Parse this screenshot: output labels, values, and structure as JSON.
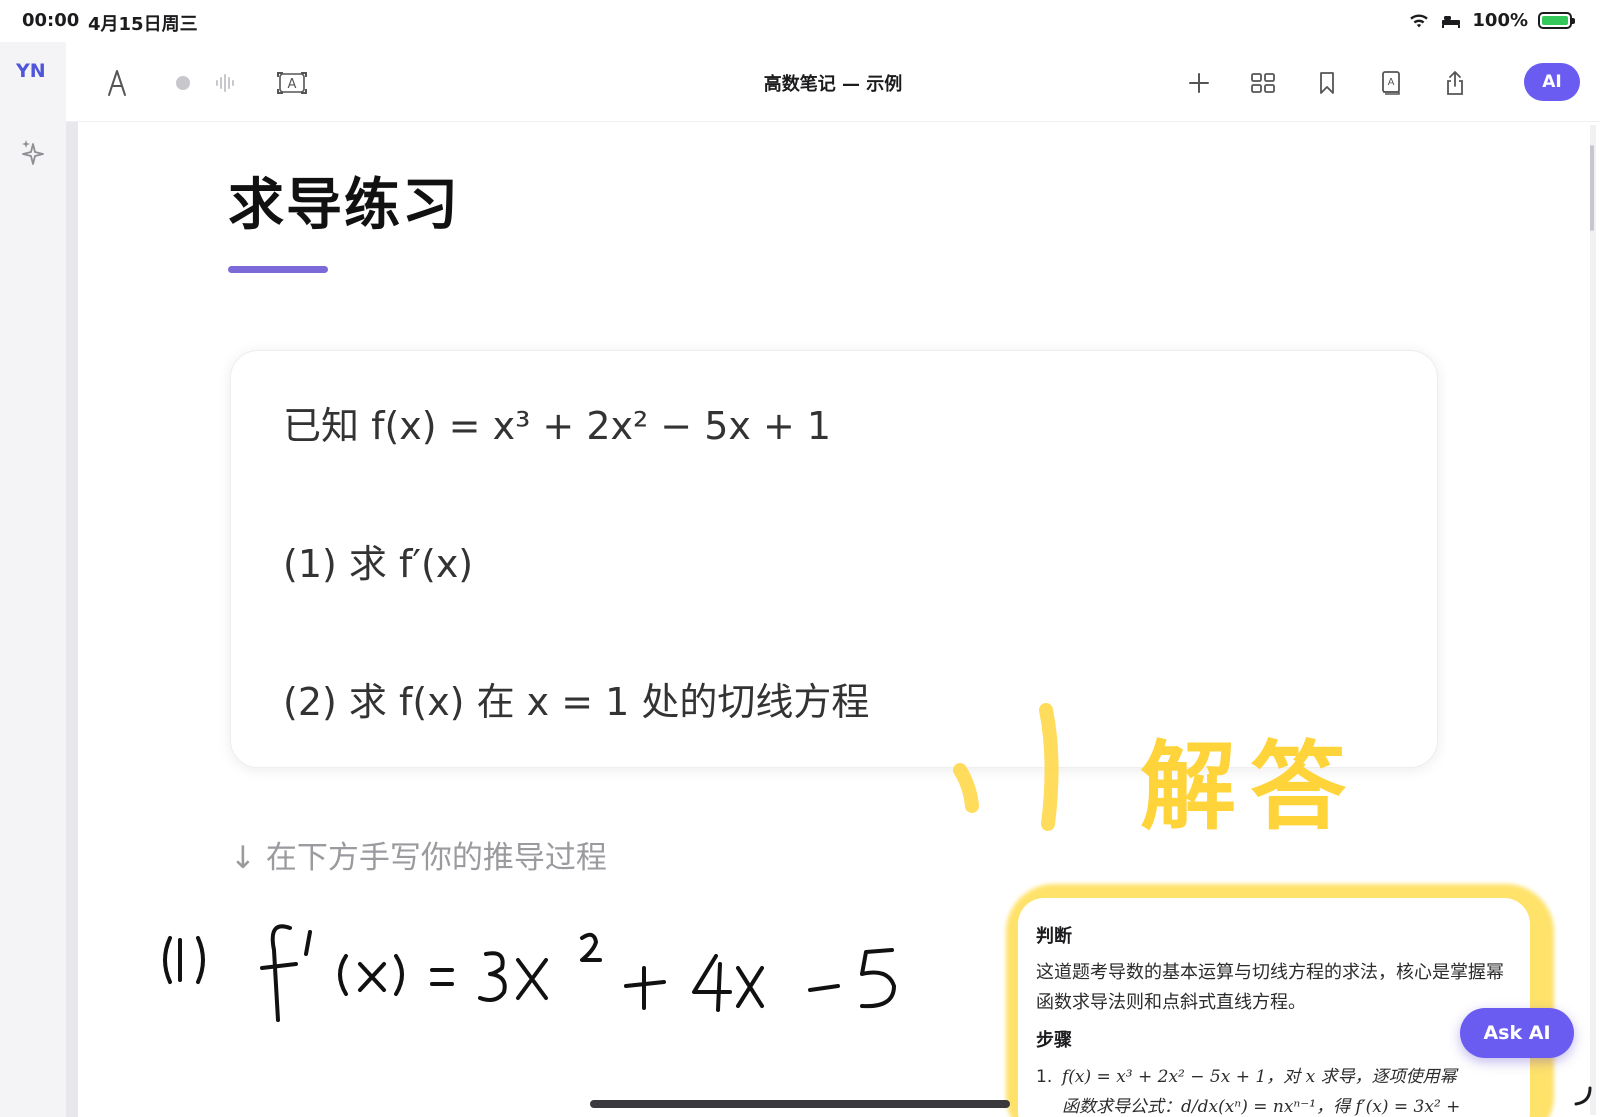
{
  "status_bar": {
    "time": "00:00",
    "date": "4月15日周三",
    "battery": "100%"
  },
  "rail": {
    "avatar_initials": "YN"
  },
  "toolbar": {
    "title": "高数笔记 — 示例",
    "ai_label": "AI"
  },
  "page": {
    "title": "求导练习",
    "accent": "#7b6ad8",
    "problem_lines": [
      "已知 f(x) = x³ + 2x² − 5x + 1",
      "(1) 求 f′(x)",
      "(2) 求 f(x) 在 x = 1 处的切线方程"
    ],
    "hint": "↓ 在下方手写你的推导过程",
    "handwritten_answer": "(1) f′(x) = 3x² + 4x − 5",
    "sticker_text": "解答"
  },
  "answer_card": {
    "heading_judge": "判断",
    "judge_text": "这道题考导数的基本运算与切线方程的求法，核心是掌握幂函数求导法则和点斜式直线方程。",
    "heading_steps": "步骤",
    "step1_num": "1.",
    "step1_text_a": "f(x) = x³ + 2x² − 5x + 1，对 x 求导，逐项使用幂",
    "step1_text_b": "函数求导公式：d/dx(xⁿ) = nxⁿ⁻¹，得 f′(x) = 3x² +"
  },
  "ask_ai_label": "Ask AI",
  "colors": {
    "brand": "#6a5cf0",
    "highlight": "#ffe26a",
    "battery": "#34c759"
  }
}
